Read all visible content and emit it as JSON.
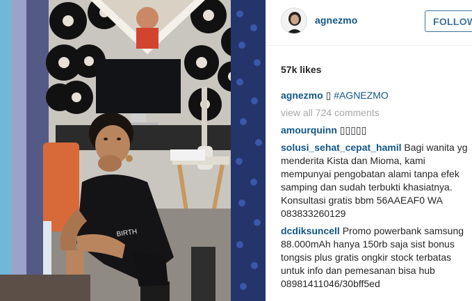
{
  "post": {
    "username": "agnezmo",
    "follow_label": "FOLLOW",
    "likes": "57k likes",
    "caption": {
      "user": "agnezmo",
      "emoji": "▯",
      "hashtag": "#AGNEZMO"
    },
    "view_all": "view all 724 comments",
    "comments": [
      {
        "user": "amourquinn",
        "text": "▯▯▯▯▯"
      },
      {
        "user": "solusi_sehat_cepat_hamil",
        "text": "Bagi wanita yg menderita Kista dan Mioma, kami mempunyai pengobatan alami tanpa efek samping dan sudah terbukti khasiatnya. Konsultasi gratis bbm 56AAEAF0 WA 083833260129"
      },
      {
        "user": "dcdiksuncell",
        "text": "Promo powerbank samsung 88.000mAh hanya 150rb saja sist bonus tongsis plus gratis ongkir stock terbatas untuk info dan pemesanan bisa hub 08981411046/30bff5ed"
      }
    ]
  },
  "photo": {
    "poster_text": "▓"
  },
  "colors": {
    "link": "#125688",
    "follow_border": "#3f729b",
    "muted": "#a5a7aa"
  },
  "icons": {
    "photo": "post-photo",
    "avatar": "profile-avatar"
  }
}
